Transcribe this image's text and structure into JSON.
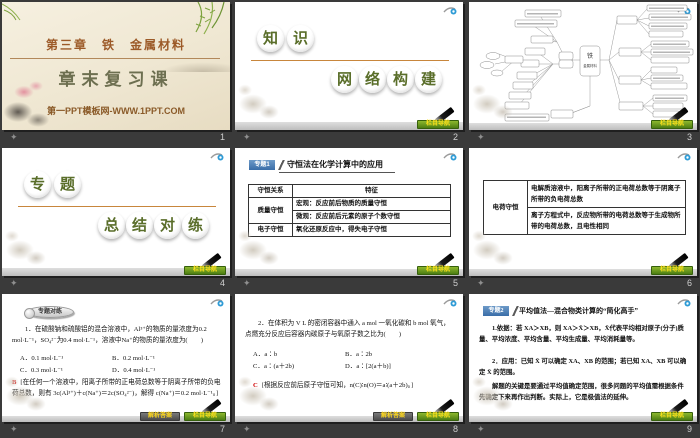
{
  "window": {
    "background": "#3a3a3a",
    "view": "slide-sorter-grid"
  },
  "colors": {
    "accent_orange": "#c8863c",
    "title_brown": "#9c5a28",
    "calligraphy_green": "#5a6e2a",
    "nav_badge_green": "#4c7d12",
    "nav_badge_text": "#ffe11a",
    "topic_badge_blue": "#3a6ea8",
    "answer_red": "#d00000"
  },
  "badges": {
    "nav": "栏目导航",
    "answer": "解析答案"
  },
  "slides": [
    {
      "number": "1",
      "chapter": "第三章　铁　金属材料",
      "title": "章末复习课",
      "footer": "第一PPT模板网-WWW.1PPT.COM"
    },
    {
      "number": "2",
      "group1": [
        "知",
        "识"
      ],
      "group2": [
        "网",
        "络",
        "构",
        "建"
      ]
    },
    {
      "number": "3",
      "center_top": "铁",
      "center_bottom": "金属材料"
    },
    {
      "number": "4",
      "group1": [
        "专",
        "题"
      ],
      "group2": [
        "总",
        "结",
        "对",
        "练"
      ]
    },
    {
      "number": "5",
      "badge": "专题1",
      "title": "守恒法在化学计算中的应用",
      "table": {
        "col1_header": "守恒关系",
        "col2_header": "特征",
        "row1_label": "质量守恒",
        "row1_line1": "宏观：反应前后物质的质量守恒",
        "row1_line2": "微观：反应前后元素的原子个数守恒",
        "row2_label": "电子守恒",
        "row2_text": "氧化还原反应中，得失电子守恒"
      }
    },
    {
      "number": "6",
      "table": {
        "row_label": "电荷守恒",
        "cell1": "电解质溶液中，阳离子所带的正电荷总数等于阴离子所带的负电荷总数",
        "cell2": "离子方程式中，反应物所带的电荷总数等于生成物所带的电荷总数，且电性相同"
      }
    },
    {
      "number": "7",
      "badge": "专题对练",
      "question": "1．在硫酸钠和硫酸铝的混合溶液中，Al³⁺的物质的量浓度为0.2 mol·L⁻¹，SO₄²⁻为0.4 mol·L⁻¹，溶液中Na⁺的物质的量浓度为(　　)",
      "optionA": "A．0.1 mol·L⁻¹",
      "optionB": "B．0.2 mol·L⁻¹",
      "optionC": "C．0.3 mol·L⁻¹",
      "optionD": "D．0.4 mol·L⁻¹",
      "answer_letter": "B",
      "answer_text": "[在任何一个溶液中，阳离子所带的正电荷总数等于阴离子所带的负电荷总数，则有 3c(Al³⁺)＋c(Na⁺)＝2c(SO₄²⁻)，解得 c(Na⁺)＝0.2 mol·L⁻¹。]"
    },
    {
      "number": "8",
      "question": "2．在体积为 V L 的密闭容器中通入 a mol 一氧化碳和 b mol 氧气，点燃充分反应后容器内碳原子与氧原子数之比为(　　)",
      "optionA": "A．a∶b",
      "optionB": "B．a∶2b",
      "optionC": "C．a∶(a＋2b)",
      "optionD": "D．a∶[2(a＋b)]",
      "answer_letter": "C",
      "answer_text": "[根据反应前后原子守恒可知，n(C)∶n(O)＝a∶(a＋2b)。]"
    },
    {
      "number": "9",
      "badge": "专题2",
      "title": "平均值法—混合物类计算的“简化高手”",
      "para1": "1.依据：若 XA＞XB，则 XA＞X̄＞XB，X̄代表平均相对原子(分子)质量、平均浓度、平均含量、平均生成量、平均消耗量等。",
      "para2": "2．应用：已知 X̄ 可以确定 XA、XB 的范围；若已知 XA、XB 可以确定 X̄ 的范围。",
      "para3": "解题的关键是要通过平均值确定范围，很多问题的平均值需根据条件先确定下来再作出判断。实际上，它是极值法的延伸。"
    }
  ]
}
